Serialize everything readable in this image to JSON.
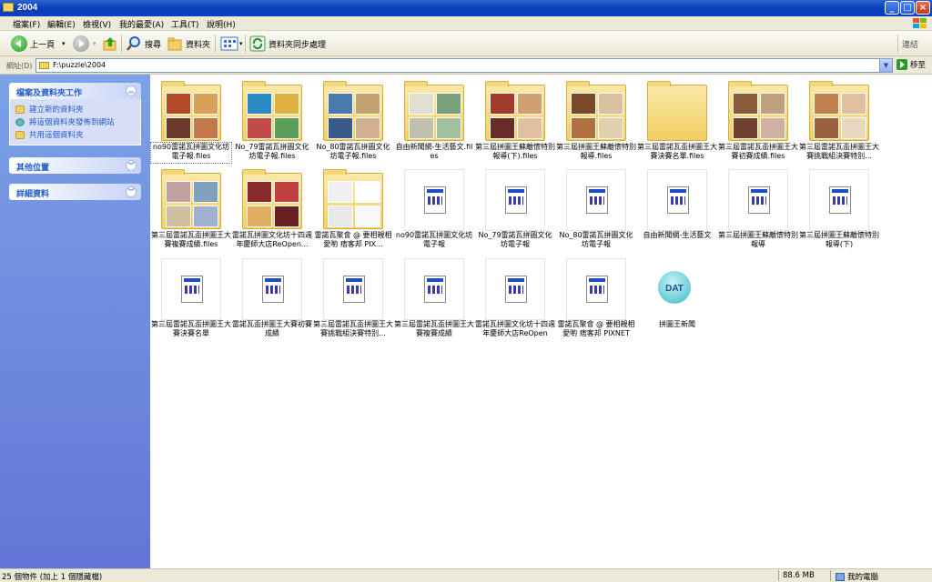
{
  "window": {
    "title": "2004",
    "buttons": {
      "minimize": "_",
      "maximize": "□",
      "close": "×"
    }
  },
  "menu": [
    "檔案(F)",
    "編輯(E)",
    "檢視(V)",
    "我的最愛(A)",
    "工具(T)",
    "說明(H)"
  ],
  "toolbar": {
    "back_label": "上一頁",
    "search_label": "搜尋",
    "folders_label": "資料夾",
    "sync_label": "資料夾同步處理",
    "links_label": "連結"
  },
  "address": {
    "label": "網址(D)",
    "value": "F:\\puzzle\\2004",
    "go_label": "移至"
  },
  "sidebar": {
    "tasks": {
      "header": "檔案及資料夾工作",
      "items": [
        "建立新的資料夾",
        "將這個資料夾發佈到網站",
        "共用這個資料夾"
      ]
    },
    "other_places": {
      "header": "其他位置"
    },
    "details": {
      "header": "詳細資料"
    }
  },
  "items": [
    {
      "label": "no90雷諾瓦拼圖文化坊電子報.files",
      "type": "folder"
    },
    {
      "label": "No_79雷諾瓦拼圖文化坊電子報.files",
      "type": "folder"
    },
    {
      "label": "No_80雷諾瓦拼圖文化坊電子報.files",
      "type": "folder"
    },
    {
      "label": "自由新聞網-生活藝文.files",
      "type": "folder"
    },
    {
      "label": "第三屆拼圖王蘇離懷特別報導(下).files",
      "type": "folder"
    },
    {
      "label": "第三屆拼圖王蘇離懷特別報導.files",
      "type": "folder"
    },
    {
      "label": "第三屆雷諾瓦盃拼圖王大賽決賽名單.files",
      "type": "folder"
    },
    {
      "label": "第三屆雷諾瓦盃拼圖王大賽初賽成績.files",
      "type": "folder"
    },
    {
      "label": "第三屆雷諾瓦盃拼圖王大賽挑戰組決賽特別...",
      "type": "folder"
    },
    {
      "label": "第三屆雷諾瓦盃拼圖王大賽複賽成績.files",
      "type": "folder"
    },
    {
      "label": "雷諾瓦拼圖文化坊十四週年慶師大店ReOpen...",
      "type": "folder"
    },
    {
      "label": "雷諾瓦聚會 @ 要相親相愛喲 痞客邦 PIX...",
      "type": "folder"
    },
    {
      "label": "no90雷諾瓦拼圖文化坊電子報",
      "type": "html"
    },
    {
      "label": "No_79雷諾瓦拼圖文化坊電子報",
      "type": "html"
    },
    {
      "label": "No_80雷諾瓦拼圖文化坊電子報",
      "type": "html"
    },
    {
      "label": "自由新聞網-生活藝文",
      "type": "html"
    },
    {
      "label": "第三屆拼圖王蘇離懷特別報導",
      "type": "html"
    },
    {
      "label": "第三屆拼圖王蘇離懷特別報導(下)",
      "type": "html"
    },
    {
      "label": "第三屆雷諾瓦盃拼圖王大賽決賽名單",
      "type": "html"
    },
    {
      "label": "雷諾瓦盃拼圖王大賽初賽成績",
      "type": "html"
    },
    {
      "label": "第三屆雷諾瓦盃拼圖王大賽挑戰組決賽特別...",
      "type": "html"
    },
    {
      "label": "第三屆雷諾瓦盃拼圖王大賽複賽成績",
      "type": "html"
    },
    {
      "label": "雷諾瓦拼圖文化坊十四週年慶師大店ReOpen",
      "type": "html"
    },
    {
      "label": "雷諾瓦聚會 @ 要相親相愛喲 痞客邦 PIXNET",
      "type": "html"
    },
    {
      "label": "拼圖王新聞",
      "type": "dat"
    }
  ],
  "dat_badge": "DAT",
  "statusbar": {
    "left": "25 個物件 (加上 1 個隱藏檔)",
    "size": "88.6 MB",
    "location": "我的電腦"
  }
}
